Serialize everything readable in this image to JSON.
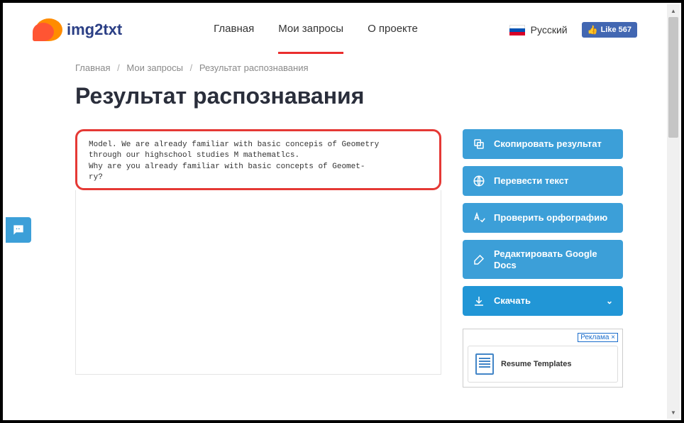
{
  "header": {
    "logo_text": "img2txt",
    "nav": {
      "home": "Главная",
      "requests": "Мои запросы",
      "about": "О проекте"
    },
    "lang_label": "Русский",
    "fb_like": "Like 567"
  },
  "breadcrumb": {
    "home": "Главная",
    "requests": "Мои запросы",
    "current": "Результат распознавания"
  },
  "page_title": "Результат распознавания",
  "result_text": "Model. We are already familiar with basic concepis of Geometry\nthrough our highschool studies M mathematlcs.\nWhy are you already familiar with basic concepts of Geomet-\nry?",
  "actions": {
    "copy": "Скопировать результат",
    "translate": "Перевести текст",
    "spellcheck": "Проверить орфографию",
    "edit_docs": "Редактировать Google Docs",
    "download": "Скачать"
  },
  "ad": {
    "label": "Реклама ×",
    "item_text": "Resume Templates"
  }
}
